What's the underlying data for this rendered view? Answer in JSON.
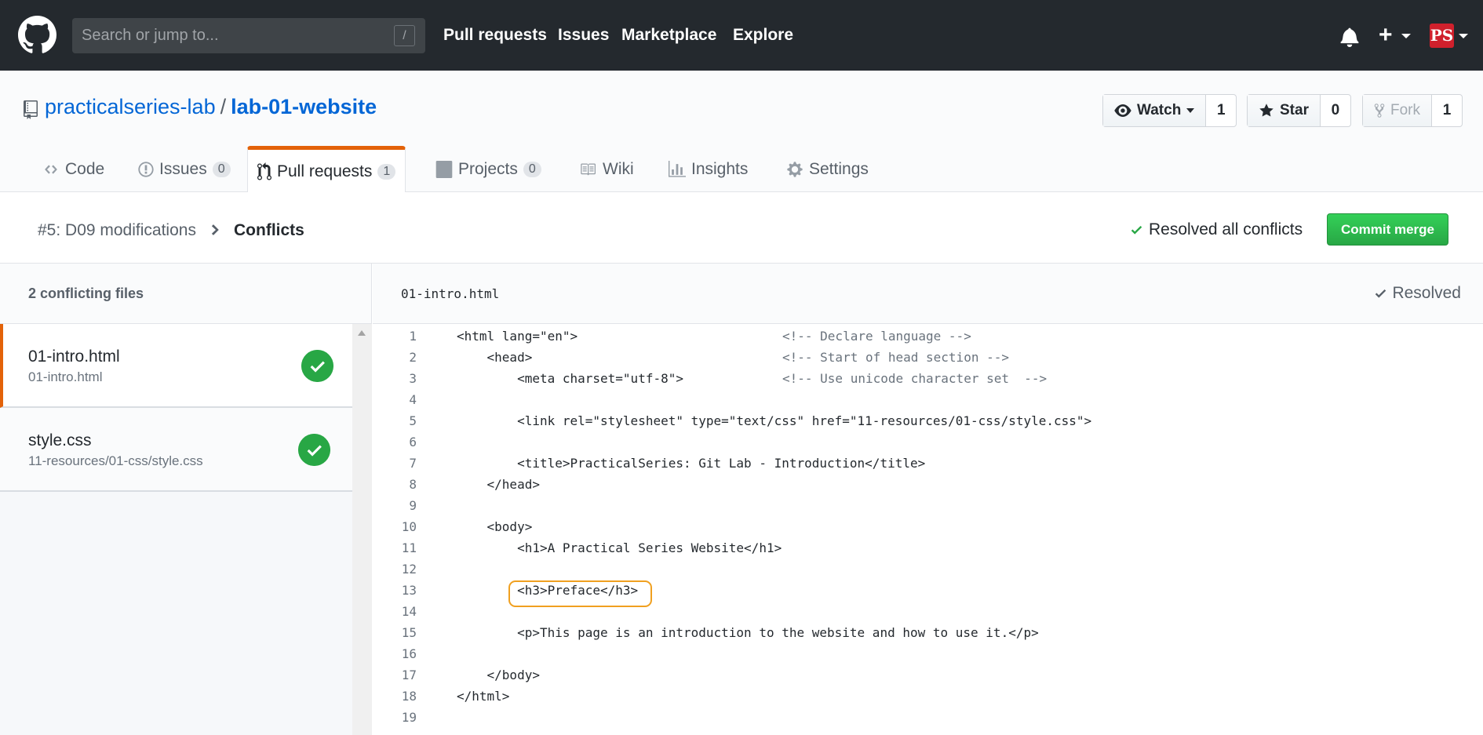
{
  "header": {
    "search_placeholder": "Search or jump to...",
    "search_shortcut": "/",
    "nav": [
      "Pull requests",
      "Issues",
      "Marketplace",
      "Explore"
    ],
    "avatar_text": "PS"
  },
  "repo": {
    "owner": "practicalseries-lab",
    "separator": "/",
    "name": "lab-01-website",
    "watch_label": "Watch",
    "watch_count": "1",
    "star_label": "Star",
    "star_count": "0",
    "fork_label": "Fork",
    "fork_count": "1"
  },
  "tabs": [
    {
      "label": "Code",
      "icon": "code-icon"
    },
    {
      "label": "Issues",
      "count": "0",
      "icon": "issue-icon"
    },
    {
      "label": "Pull requests",
      "count": "1",
      "icon": "pull-request-icon",
      "selected": true
    },
    {
      "label": "Projects",
      "count": "0",
      "icon": "project-icon"
    },
    {
      "label": "Wiki",
      "icon": "book-icon"
    },
    {
      "label": "Insights",
      "icon": "graph-icon"
    },
    {
      "label": "Settings",
      "icon": "gear-icon"
    }
  ],
  "merge": {
    "breadcrumb_pr": "#5: D09 modifications",
    "breadcrumb_current": "Conflicts",
    "status": "Resolved all conflicts",
    "commit_label": "Commit merge"
  },
  "sidebar": {
    "title": "2 conflicting files",
    "files": [
      {
        "name": "01-intro.html",
        "path": "01-intro.html",
        "resolved": true
      },
      {
        "name": "style.css",
        "path": "11-resources/01-css/style.css",
        "resolved": true
      }
    ]
  },
  "editor": {
    "filename": "01-intro.html",
    "status": "Resolved",
    "lines": [
      {
        "n": "1",
        "code": "<html lang=\"en\">",
        "comment": "<!-- Declare language -->"
      },
      {
        "n": "2",
        "code": "    <head>",
        "comment": "<!-- Start of head section -->"
      },
      {
        "n": "3",
        "code": "        <meta charset=\"utf-8\">",
        "comment": "<!-- Use unicode character set  -->"
      },
      {
        "n": "4",
        "code": "",
        "comment": ""
      },
      {
        "n": "5",
        "code": "        <link rel=\"stylesheet\" type=\"text/css\" href=\"11-resources/01-css/style.css\">",
        "comment": ""
      },
      {
        "n": "6",
        "code": "",
        "comment": ""
      },
      {
        "n": "7",
        "code": "        <title>PracticalSeries: Git Lab - Introduction</title>",
        "comment": ""
      },
      {
        "n": "8",
        "code": "    </head>",
        "comment": ""
      },
      {
        "n": "9",
        "code": "",
        "comment": ""
      },
      {
        "n": "10",
        "code": "    <body>",
        "comment": ""
      },
      {
        "n": "11",
        "code": "        <h1>A Practical Series Website</h1>",
        "comment": ""
      },
      {
        "n": "12",
        "code": "",
        "comment": ""
      },
      {
        "n": "13",
        "code": "        <h3>Preface</h3>",
        "comment": ""
      },
      {
        "n": "14",
        "code": "",
        "comment": ""
      },
      {
        "n": "15",
        "code": "        <p>This page is an introduction to the website and how to use it.</p>",
        "comment": ""
      },
      {
        "n": "16",
        "code": "",
        "comment": ""
      },
      {
        "n": "17",
        "code": "    </body>",
        "comment": ""
      },
      {
        "n": "18",
        "code": "</html>",
        "comment": ""
      },
      {
        "n": "19",
        "code": "",
        "comment": ""
      }
    ]
  },
  "colors": {
    "header_bg": "#24292e",
    "link": "#0366d6",
    "accent_tab": "#e36209",
    "success": "#28a745",
    "highlight": "#f0a020"
  }
}
